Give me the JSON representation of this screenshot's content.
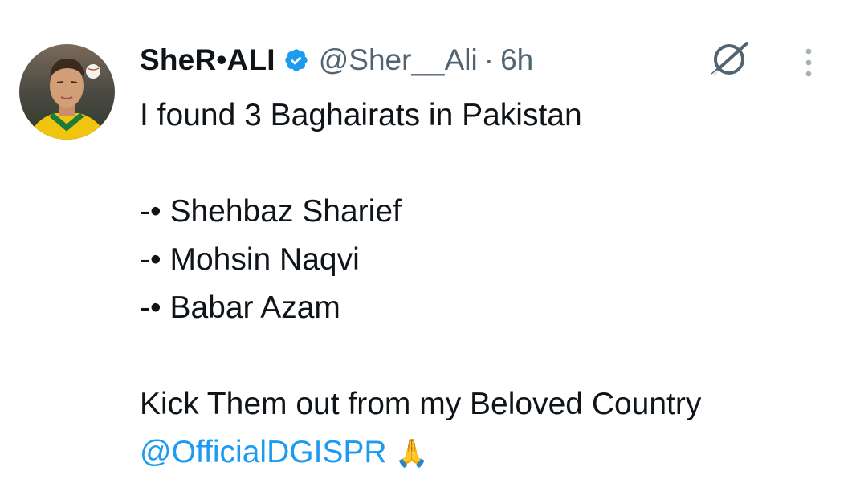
{
  "tweet": {
    "author": {
      "display_name": "SheR•ALI",
      "handle": "@Sher__Ali",
      "verified": true
    },
    "separator": "·",
    "timestamp": "6h",
    "lines": [
      "I found 3 Baghairats in Pakistan",
      "",
      "-• Shehbaz Sharief",
      "-• Mohsin Naqvi",
      "-• Babar Azam",
      "",
      "Kick Them out from my Beloved Country"
    ],
    "mention": "@OfficialDGISPR",
    "emoji": "🙏"
  },
  "icons": {
    "verified": "verified-badge-icon",
    "grok": "grok-icon",
    "more": "more-options-icon"
  },
  "colors": {
    "text": "#0f1419",
    "secondary": "#536471",
    "link": "#1d9bf0",
    "verified": "#1d9bf0"
  }
}
